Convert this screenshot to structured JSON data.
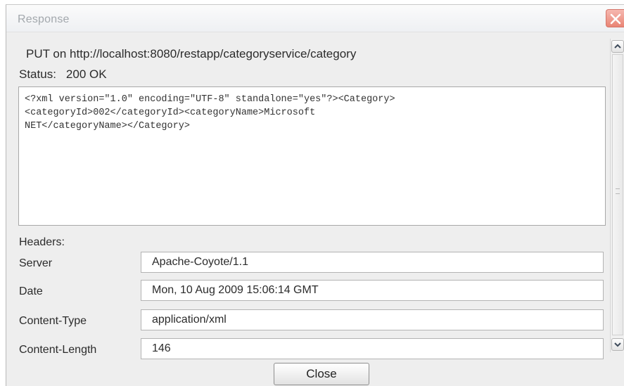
{
  "window": {
    "title": "Response"
  },
  "response": {
    "request_line": "PUT on http://localhost:8080/restapp/categoryservice/category",
    "status_label": "Status:",
    "status_value": "200 OK",
    "body": "<?xml version=\"1.0\" encoding=\"UTF-8\" standalone=\"yes\"?><Category>\n<categoryId>002</categoryId><categoryName>Microsoft\nNET</categoryName></Category>"
  },
  "headers": {
    "label": "Headers:",
    "rows": [
      {
        "name": "Server",
        "value": "Apache-Coyote/1.1"
      },
      {
        "name": "Date",
        "value": "Mon, 10 Aug 2009 15:06:14 GMT"
      },
      {
        "name": "Content-Type",
        "value": "application/xml"
      },
      {
        "name": "Content-Length",
        "value": "146"
      }
    ]
  },
  "footer": {
    "close_label": "Close"
  },
  "icons": {
    "window_close": "close-icon",
    "scroll_up": "chevron-up-icon",
    "scroll_down": "chevron-down-icon"
  },
  "colors": {
    "title_text": "#a3a8ad",
    "close_accent": "#e98575"
  }
}
